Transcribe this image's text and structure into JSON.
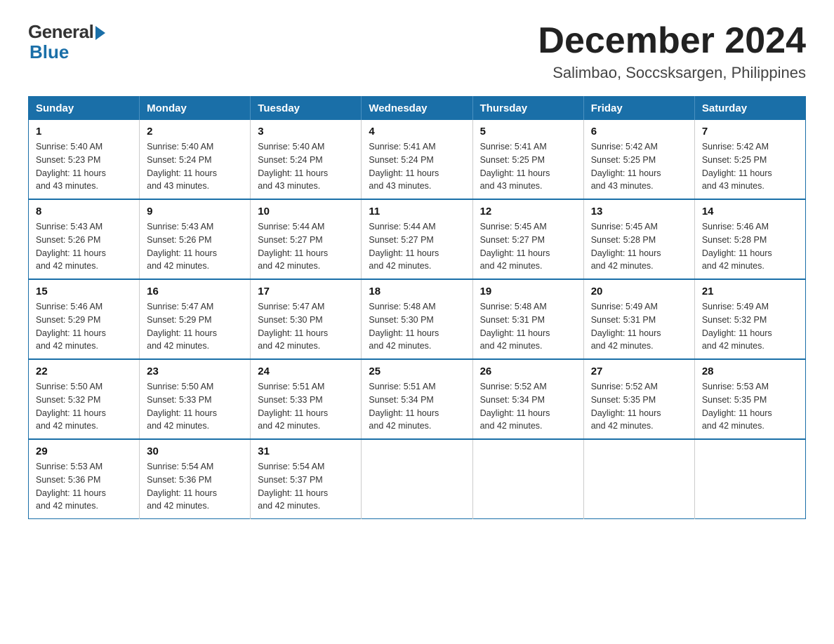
{
  "header": {
    "logo_general": "General",
    "logo_blue": "Blue",
    "month_title": "December 2024",
    "location": "Salimbao, Soccsksargen, Philippines"
  },
  "days_of_week": [
    "Sunday",
    "Monday",
    "Tuesday",
    "Wednesday",
    "Thursday",
    "Friday",
    "Saturday"
  ],
  "weeks": [
    [
      {
        "day": "1",
        "sunrise": "5:40 AM",
        "sunset": "5:23 PM",
        "daylight": "11 hours and 43 minutes."
      },
      {
        "day": "2",
        "sunrise": "5:40 AM",
        "sunset": "5:24 PM",
        "daylight": "11 hours and 43 minutes."
      },
      {
        "day": "3",
        "sunrise": "5:40 AM",
        "sunset": "5:24 PM",
        "daylight": "11 hours and 43 minutes."
      },
      {
        "day": "4",
        "sunrise": "5:41 AM",
        "sunset": "5:24 PM",
        "daylight": "11 hours and 43 minutes."
      },
      {
        "day": "5",
        "sunrise": "5:41 AM",
        "sunset": "5:25 PM",
        "daylight": "11 hours and 43 minutes."
      },
      {
        "day": "6",
        "sunrise": "5:42 AM",
        "sunset": "5:25 PM",
        "daylight": "11 hours and 43 minutes."
      },
      {
        "day": "7",
        "sunrise": "5:42 AM",
        "sunset": "5:25 PM",
        "daylight": "11 hours and 43 minutes."
      }
    ],
    [
      {
        "day": "8",
        "sunrise": "5:43 AM",
        "sunset": "5:26 PM",
        "daylight": "11 hours and 42 minutes."
      },
      {
        "day": "9",
        "sunrise": "5:43 AM",
        "sunset": "5:26 PM",
        "daylight": "11 hours and 42 minutes."
      },
      {
        "day": "10",
        "sunrise": "5:44 AM",
        "sunset": "5:27 PM",
        "daylight": "11 hours and 42 minutes."
      },
      {
        "day": "11",
        "sunrise": "5:44 AM",
        "sunset": "5:27 PM",
        "daylight": "11 hours and 42 minutes."
      },
      {
        "day": "12",
        "sunrise": "5:45 AM",
        "sunset": "5:27 PM",
        "daylight": "11 hours and 42 minutes."
      },
      {
        "day": "13",
        "sunrise": "5:45 AM",
        "sunset": "5:28 PM",
        "daylight": "11 hours and 42 minutes."
      },
      {
        "day": "14",
        "sunrise": "5:46 AM",
        "sunset": "5:28 PM",
        "daylight": "11 hours and 42 minutes."
      }
    ],
    [
      {
        "day": "15",
        "sunrise": "5:46 AM",
        "sunset": "5:29 PM",
        "daylight": "11 hours and 42 minutes."
      },
      {
        "day": "16",
        "sunrise": "5:47 AM",
        "sunset": "5:29 PM",
        "daylight": "11 hours and 42 minutes."
      },
      {
        "day": "17",
        "sunrise": "5:47 AM",
        "sunset": "5:30 PM",
        "daylight": "11 hours and 42 minutes."
      },
      {
        "day": "18",
        "sunrise": "5:48 AM",
        "sunset": "5:30 PM",
        "daylight": "11 hours and 42 minutes."
      },
      {
        "day": "19",
        "sunrise": "5:48 AM",
        "sunset": "5:31 PM",
        "daylight": "11 hours and 42 minutes."
      },
      {
        "day": "20",
        "sunrise": "5:49 AM",
        "sunset": "5:31 PM",
        "daylight": "11 hours and 42 minutes."
      },
      {
        "day": "21",
        "sunrise": "5:49 AM",
        "sunset": "5:32 PM",
        "daylight": "11 hours and 42 minutes."
      }
    ],
    [
      {
        "day": "22",
        "sunrise": "5:50 AM",
        "sunset": "5:32 PM",
        "daylight": "11 hours and 42 minutes."
      },
      {
        "day": "23",
        "sunrise": "5:50 AM",
        "sunset": "5:33 PM",
        "daylight": "11 hours and 42 minutes."
      },
      {
        "day": "24",
        "sunrise": "5:51 AM",
        "sunset": "5:33 PM",
        "daylight": "11 hours and 42 minutes."
      },
      {
        "day": "25",
        "sunrise": "5:51 AM",
        "sunset": "5:34 PM",
        "daylight": "11 hours and 42 minutes."
      },
      {
        "day": "26",
        "sunrise": "5:52 AM",
        "sunset": "5:34 PM",
        "daylight": "11 hours and 42 minutes."
      },
      {
        "day": "27",
        "sunrise": "5:52 AM",
        "sunset": "5:35 PM",
        "daylight": "11 hours and 42 minutes."
      },
      {
        "day": "28",
        "sunrise": "5:53 AM",
        "sunset": "5:35 PM",
        "daylight": "11 hours and 42 minutes."
      }
    ],
    [
      {
        "day": "29",
        "sunrise": "5:53 AM",
        "sunset": "5:36 PM",
        "daylight": "11 hours and 42 minutes."
      },
      {
        "day": "30",
        "sunrise": "5:54 AM",
        "sunset": "5:36 PM",
        "daylight": "11 hours and 42 minutes."
      },
      {
        "day": "31",
        "sunrise": "5:54 AM",
        "sunset": "5:37 PM",
        "daylight": "11 hours and 42 minutes."
      },
      null,
      null,
      null,
      null
    ]
  ],
  "labels": {
    "sunrise": "Sunrise:",
    "sunset": "Sunset:",
    "daylight": "Daylight:"
  }
}
